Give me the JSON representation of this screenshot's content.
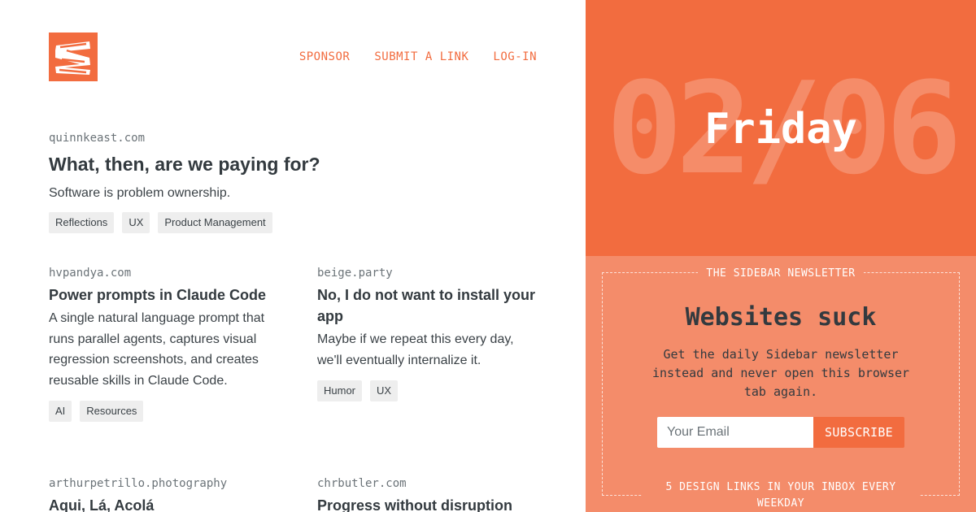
{
  "nav": {
    "items": [
      {
        "label": "SPONSOR"
      },
      {
        "label": "SUBMIT A LINK"
      },
      {
        "label": "LOG-IN"
      }
    ]
  },
  "featured": {
    "domain": "quinnkeast.com",
    "title": "What, then, are we paying for?",
    "description": "Software is problem ownership.",
    "tags": [
      "Reflections",
      "UX",
      "Product Management"
    ]
  },
  "links": [
    {
      "domain": "hvpandya.com",
      "title": "Power prompts in Claude Code",
      "description": "A single natural language prompt that runs parallel agents, captures visual regression screenshots, and creates reusable skills in Claude Code.",
      "tags": [
        "AI",
        "Resources"
      ]
    },
    {
      "domain": "beige.party",
      "title": "No, I do not want to install your app",
      "description": "Maybe if we repeat this every day, we'll eventually internalize it.",
      "tags": [
        "Humor",
        "UX"
      ]
    },
    {
      "domain": "arthurpetrillo.photography",
      "title": "Aqui, Lá, Acolá",
      "description": "",
      "tags": []
    },
    {
      "domain": "chrbutler.com",
      "title": "Progress without disruption",
      "description": "",
      "tags": []
    }
  ],
  "date": {
    "big": "02/06",
    "weekday": "Friday"
  },
  "newsletter": {
    "label": "THE SIDEBAR NEWSLETTER",
    "heading": "Websites suck",
    "description": "Get the daily Sidebar newsletter instead and never open this browser tab again.",
    "email_placeholder": "Your Email",
    "subscribe_label": "SUBSCRIBE",
    "footer": "5 DESIGN LINKS IN YOUR INBOX EVERY WEEKDAY"
  },
  "colors": {
    "accent": "#f26c3f",
    "accent_light": "#f48c6a",
    "text": "#333a3f",
    "tag_bg": "#eeeeee"
  }
}
